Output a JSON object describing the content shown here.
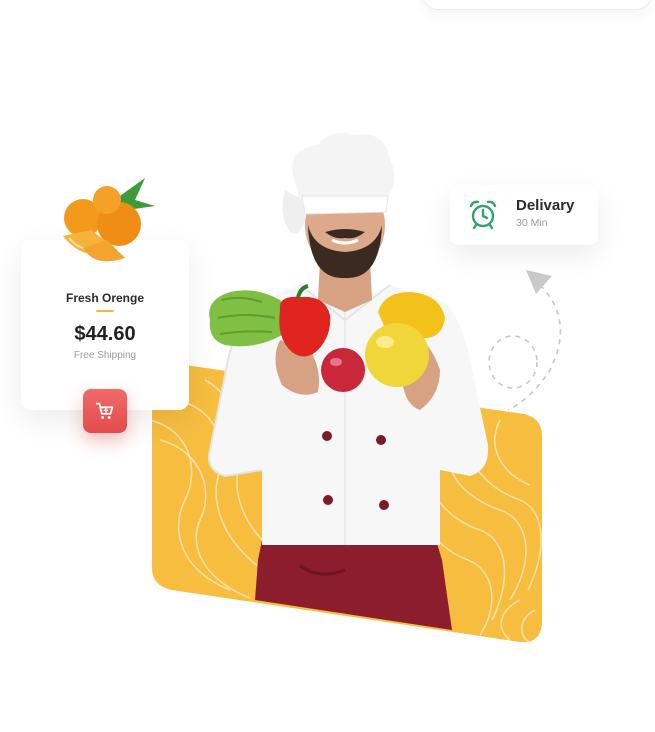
{
  "colors": {
    "accent_yellow": "#f6bd3f",
    "cart_red": "#e14b4b",
    "delivery_green": "#2fa36b",
    "apron_red": "#8c1d2c",
    "text_dark": "#2b2b2b",
    "text_muted": "#9a9a9a"
  },
  "product_card": {
    "name": "Fresh Orenge",
    "price": "$44.60",
    "shipping": "Free Shipping",
    "image_icon": "orange-image",
    "cart_icon": "cart-icon"
  },
  "delivery_card": {
    "title": "Delivary",
    "time": "30 Min",
    "icon": "alarm-clock-icon"
  },
  "hero": {
    "image_subject": "chef-holding-vegetables"
  }
}
